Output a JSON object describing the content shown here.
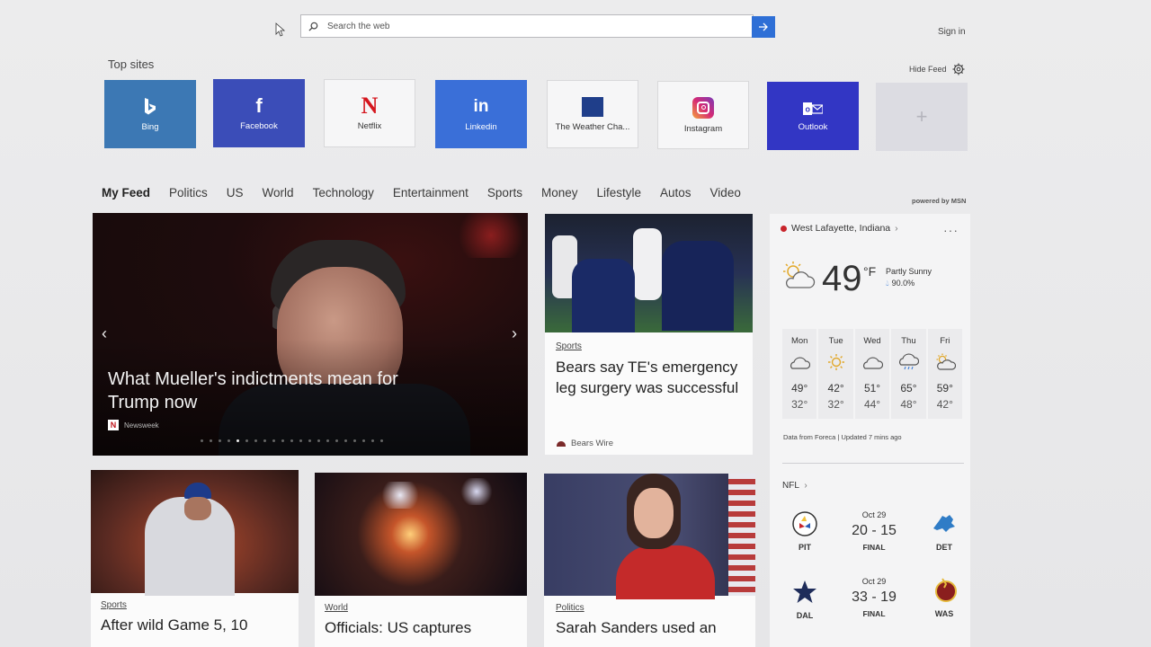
{
  "search": {
    "placeholder": "Search the web"
  },
  "header": {
    "sign_in": "Sign in"
  },
  "top_sites": {
    "label": "Top sites",
    "hide_feed": "Hide Feed",
    "tiles": [
      {
        "name": "Bing",
        "color": "#3c78b4"
      },
      {
        "name": "Facebook",
        "color": "#3b4db8"
      },
      {
        "name": "Netflix",
        "color": "#f6f6f7"
      },
      {
        "name": "Linkedin",
        "color": "#3a6fd8"
      },
      {
        "name": "The Weather Cha...",
        "color": "#f6f6f7"
      },
      {
        "name": "Instagram",
        "color": "#f6f6f7"
      },
      {
        "name": "Outlook",
        "color": "#3236c4"
      }
    ]
  },
  "nav": {
    "items": [
      "My Feed",
      "Politics",
      "US",
      "World",
      "Technology",
      "Entertainment",
      "Sports",
      "Money",
      "Lifestyle",
      "Autos",
      "Video"
    ],
    "powered_by": "powered by MSN"
  },
  "hero": {
    "title": "What Mueller's indictments mean for Trump now",
    "source": "Newsweek"
  },
  "cards": {
    "bears": {
      "category": "Sports",
      "headline": "Bears say TE's emergency leg surgery was successful",
      "source": "Bears Wire"
    },
    "game5": {
      "category": "Sports",
      "headline": "After wild Game 5, 10"
    },
    "officials": {
      "category": "World",
      "headline": "Officials: US captures"
    },
    "sanders": {
      "category": "Politics",
      "headline": "Sarah Sanders used an"
    }
  },
  "weather": {
    "location": "West Lafayette, Indiana",
    "temp": "49",
    "unit": "°F",
    "condition": "Partly Sunny",
    "precip": "90.0%",
    "days": [
      {
        "day": "Mon",
        "hi": "49°",
        "lo": "32°",
        "icon": "cloud-icon"
      },
      {
        "day": "Tue",
        "hi": "42°",
        "lo": "32°",
        "icon": "sun-icon"
      },
      {
        "day": "Wed",
        "hi": "51°",
        "lo": "44°",
        "icon": "cloud-icon"
      },
      {
        "day": "Thu",
        "hi": "65°",
        "lo": "48°",
        "icon": "rain-icon"
      },
      {
        "day": "Fri",
        "hi": "59°",
        "lo": "42°",
        "icon": "partly-sunny-icon"
      }
    ],
    "data_note": "Data from Foreca | Updated 7 mins ago"
  },
  "nfl": {
    "label": "NFL",
    "games": [
      {
        "date": "Oct 29",
        "score": "20 - 15",
        "status": "FINAL",
        "home": "PIT",
        "away": "DET"
      },
      {
        "date": "Oct 29",
        "score": "33 - 19",
        "status": "FINAL",
        "home": "DAL",
        "away": "WAS"
      }
    ]
  }
}
